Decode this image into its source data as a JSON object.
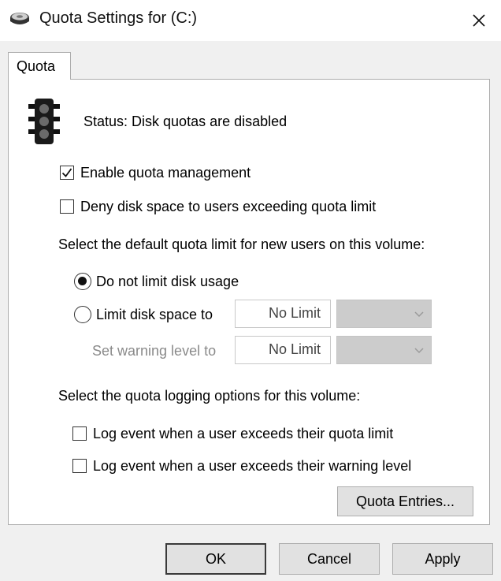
{
  "window": {
    "title": "Quota Settings for  (C:)",
    "icon": "drive-icon",
    "close_glyph": "✕"
  },
  "tabs": [
    {
      "label": "Quota",
      "selected": true
    }
  ],
  "status": {
    "icon": "traffic-light-icon",
    "text": "Status:  Disk quotas are disabled"
  },
  "options": {
    "enable_quota": {
      "label": "Enable quota management",
      "checked": true
    },
    "deny_space": {
      "label": "Deny disk space to users exceeding quota limit",
      "checked": false
    }
  },
  "default_limit": {
    "heading": "Select the default quota limit for new users on this volume:",
    "no_limit_label": "Do not limit disk usage",
    "no_limit_selected": true,
    "limit_label": "Limit disk space to",
    "limit_value": "No Limit",
    "warning_label": "Set warning level to",
    "warning_value": "No Limit"
  },
  "logging": {
    "heading": "Select the quota logging options for this volume:",
    "log_limit_label": "Log event when a user exceeds their quota limit",
    "log_limit_checked": false,
    "log_warning_label": "Log event when a user exceeds their warning level",
    "log_warning_checked": false
  },
  "buttons": {
    "quota_entries": "Quota Entries...",
    "ok": "OK",
    "cancel": "Cancel",
    "apply": "Apply"
  }
}
